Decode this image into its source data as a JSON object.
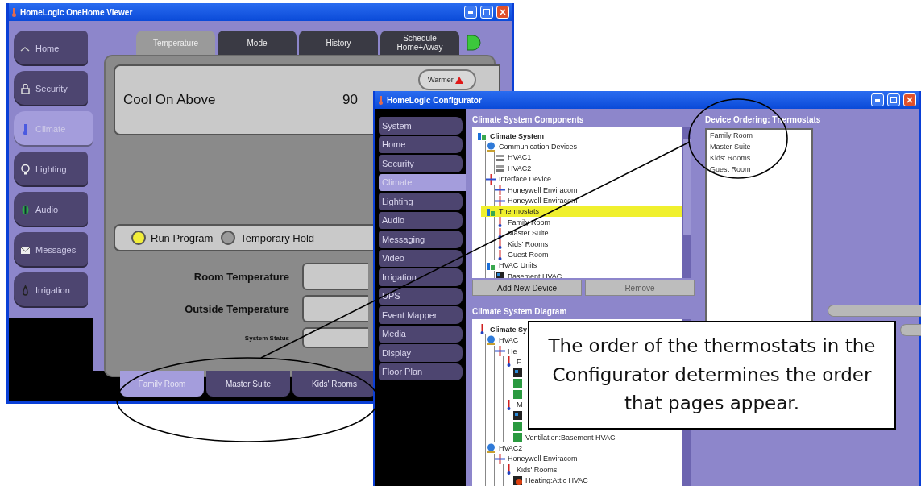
{
  "viewer": {
    "title": "HomeLogic OneHome Viewer",
    "nav": [
      {
        "label": "Home",
        "kind": "home",
        "selected": false
      },
      {
        "label": "Security",
        "kind": "lock",
        "selected": false
      },
      {
        "label": "Climate",
        "kind": "thermometer",
        "selected": true
      },
      {
        "label": "Lighting",
        "kind": "bulb",
        "selected": false
      },
      {
        "label": "Audio",
        "kind": "speaker",
        "selected": false
      },
      {
        "label": "Messages",
        "kind": "mail",
        "selected": false
      },
      {
        "label": "Irrigation",
        "kind": "drop",
        "selected": false
      }
    ],
    "tabs": [
      {
        "label": "Temperature",
        "selected": true
      },
      {
        "label": "Mode",
        "selected": false
      },
      {
        "label": "History",
        "selected": false
      },
      {
        "label": "Schedule Home+Away",
        "selected": false
      }
    ],
    "setpoint": {
      "label": "Cool On Above",
      "value": "90",
      "button": "Warmer"
    },
    "modes": [
      {
        "label": "Run Program",
        "selected": true
      },
      {
        "label": "Temporary Hold",
        "selected": false
      }
    ],
    "fields": [
      {
        "label": "Room Temperature",
        "kind": "large"
      },
      {
        "label": "Outside Temperature",
        "kind": "large"
      },
      {
        "label": "System Status",
        "kind": "small"
      }
    ],
    "room_tabs": [
      {
        "label": "Family Room",
        "selected": true
      },
      {
        "label": "Master Suite",
        "selected": false
      },
      {
        "label": "Kids' Rooms",
        "selected": false
      }
    ]
  },
  "configurator": {
    "title": "HomeLogic Configurator",
    "nav": [
      {
        "label": "System",
        "selected": false
      },
      {
        "label": "Home",
        "selected": false
      },
      {
        "label": "Security",
        "selected": false
      },
      {
        "label": "Climate",
        "selected": true
      },
      {
        "label": "Lighting",
        "selected": false
      },
      {
        "label": "Audio",
        "selected": false
      },
      {
        "label": "Messaging",
        "selected": false
      },
      {
        "label": "Video",
        "selected": false
      },
      {
        "label": "Irrigation",
        "selected": false
      },
      {
        "label": "UPS",
        "selected": false
      },
      {
        "label": "Event Mapper",
        "selected": false
      },
      {
        "label": "Media",
        "selected": false
      },
      {
        "label": "Display",
        "selected": false
      },
      {
        "label": "Floor Plan",
        "selected": false
      }
    ],
    "components": {
      "title": "Climate System Components",
      "tree": [
        {
          "label": "Climate System",
          "kind": "climate",
          "selected": false,
          "children": [
            {
              "label": "Communication Devices",
              "kind": "device",
              "selected": false,
              "children": [
                {
                  "label": "HVAC1",
                  "kind": "hvac",
                  "selected": false
                },
                {
                  "label": "HVAC2",
                  "kind": "hvac",
                  "selected": false
                }
              ]
            },
            {
              "label": "Interface Device",
              "kind": "interface",
              "selected": false,
              "children": [
                {
                  "label": "Honeywell Enviracom",
                  "kind": "interface",
                  "selected": false
                },
                {
                  "label": "Honeywell Enviracom",
                  "kind": "interface",
                  "selected": false
                }
              ]
            },
            {
              "label": "Thermostats",
              "kind": "climate",
              "selected": true,
              "children": [
                {
                  "label": "Family Room",
                  "kind": "thermostat",
                  "selected": false
                },
                {
                  "label": "Master Suite",
                  "kind": "thermostat",
                  "selected": false
                },
                {
                  "label": "Kids' Rooms",
                  "kind": "thermostat",
                  "selected": false
                },
                {
                  "label": "Guest Room",
                  "kind": "thermostat",
                  "selected": false
                }
              ]
            },
            {
              "label": "HVAC Units",
              "kind": "climate",
              "selected": false,
              "children": [
                {
                  "label": "Basement HVAC",
                  "kind": "unit",
                  "selected": false
                }
              ]
            }
          ]
        }
      ],
      "buttons": [
        {
          "label": "Add New Device",
          "disabled": false
        },
        {
          "label": "Remove",
          "disabled": true
        }
      ]
    },
    "diagram": {
      "title": "Climate System Diagram",
      "tree": [
        {
          "label": "Climate Sy",
          "kind": "thermostat",
          "children": [
            {
              "label": "HVAC",
              "kind": "device",
              "children": [
                {
                  "label": "He",
                  "kind": "interface",
                  "children": [
                    {
                      "label": "F",
                      "kind": "thermostat",
                      "children": [
                        {
                          "kind": "unit"
                        },
                        {
                          "kind": "vent"
                        },
                        {
                          "kind": "vent"
                        }
                      ]
                    },
                    {
                      "label": "M",
                      "kind": "thermostat",
                      "children": [
                        {
                          "kind": "unit"
                        },
                        {
                          "kind": "vent"
                        },
                        {
                          "label": "Ventilation:Basement HVAC",
                          "kind": "vent"
                        }
                      ]
                    }
                  ]
                }
              ]
            },
            {
              "label": "HVAC2",
              "kind": "device",
              "children": [
                {
                  "label": "Honeywell Enviracom",
                  "kind": "interface",
                  "children": [
                    {
                      "label": "Kids' Rooms",
                      "kind": "thermostat",
                      "children": [
                        {
                          "label": "Heating:Attic HVAC",
                          "kind": "heat"
                        }
                      ]
                    }
                  ]
                }
              ]
            }
          ]
        }
      ]
    },
    "ordering": {
      "title": "Device Ordering: Thermostats",
      "items": [
        "Family Room",
        "Master Suite",
        "Kids' Rooms",
        "Guest Room"
      ]
    }
  },
  "callout": {
    "text": "The order of the thermostats in the Configurator determines the order that pages appear."
  }
}
